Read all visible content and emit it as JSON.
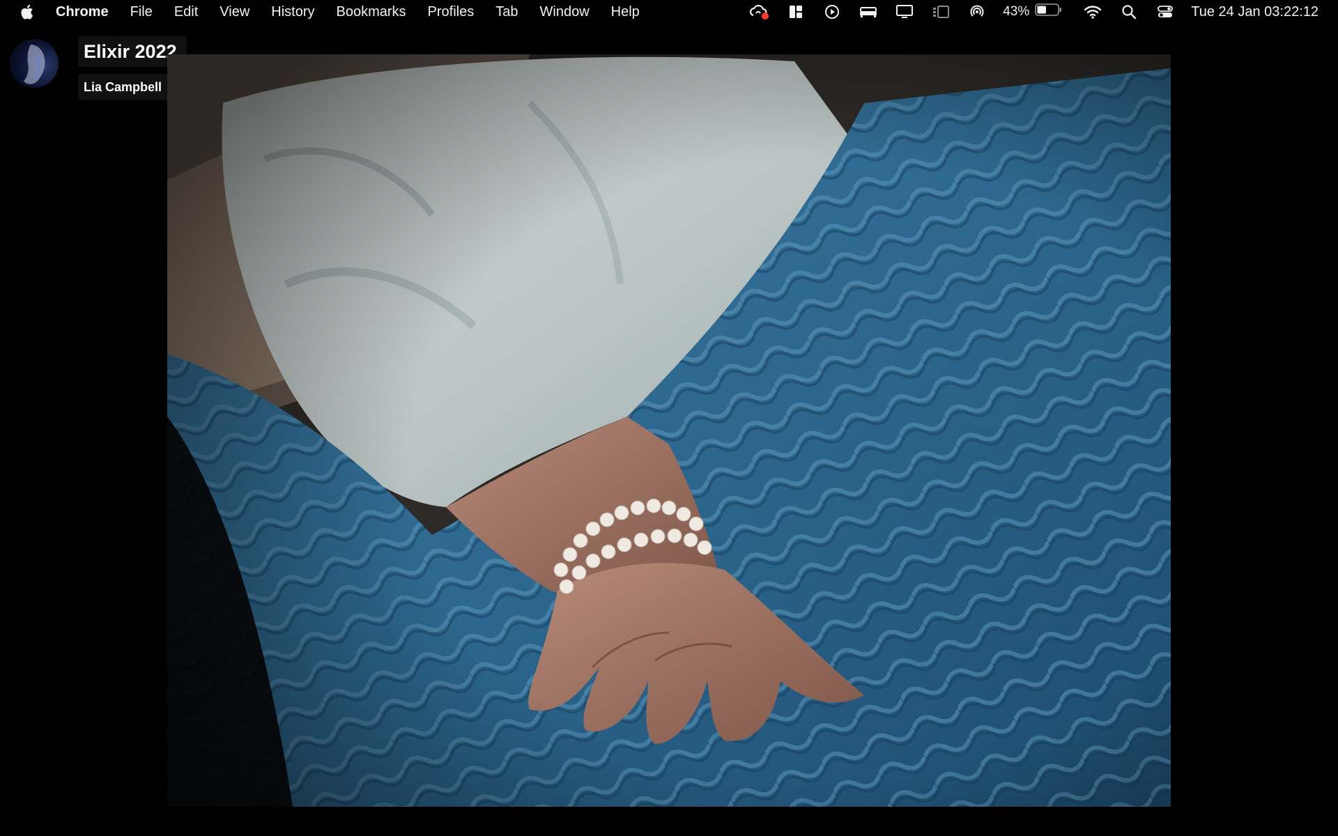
{
  "menubar": {
    "apple_icon": "apple-logo-icon",
    "app_name": "Chrome",
    "menus": [
      "File",
      "Edit",
      "View",
      "History",
      "Bookmarks",
      "Profiles",
      "Tab",
      "Window",
      "Help"
    ],
    "status_icons": [
      "creative-cloud-icon",
      "layout-icon",
      "play-circle-icon",
      "bed-icon",
      "display-icon",
      "stage-manager-icon",
      "airdrop-icon"
    ],
    "battery_percent": "43%",
    "battery_level": 0.43,
    "right_icons": [
      "wifi-icon",
      "search-icon",
      "control-center-icon"
    ],
    "clock": "Tue 24 Jan  03:22:12"
  },
  "player": {
    "title": "Elixir 2022",
    "author": "Lia Campbell",
    "avatar_icon": "author-avatar"
  },
  "colors": {
    "background": "#000000",
    "blanket": "#2e6a92",
    "sleeve": "#c9d2d0",
    "notification_dot": "#ff3b30"
  }
}
